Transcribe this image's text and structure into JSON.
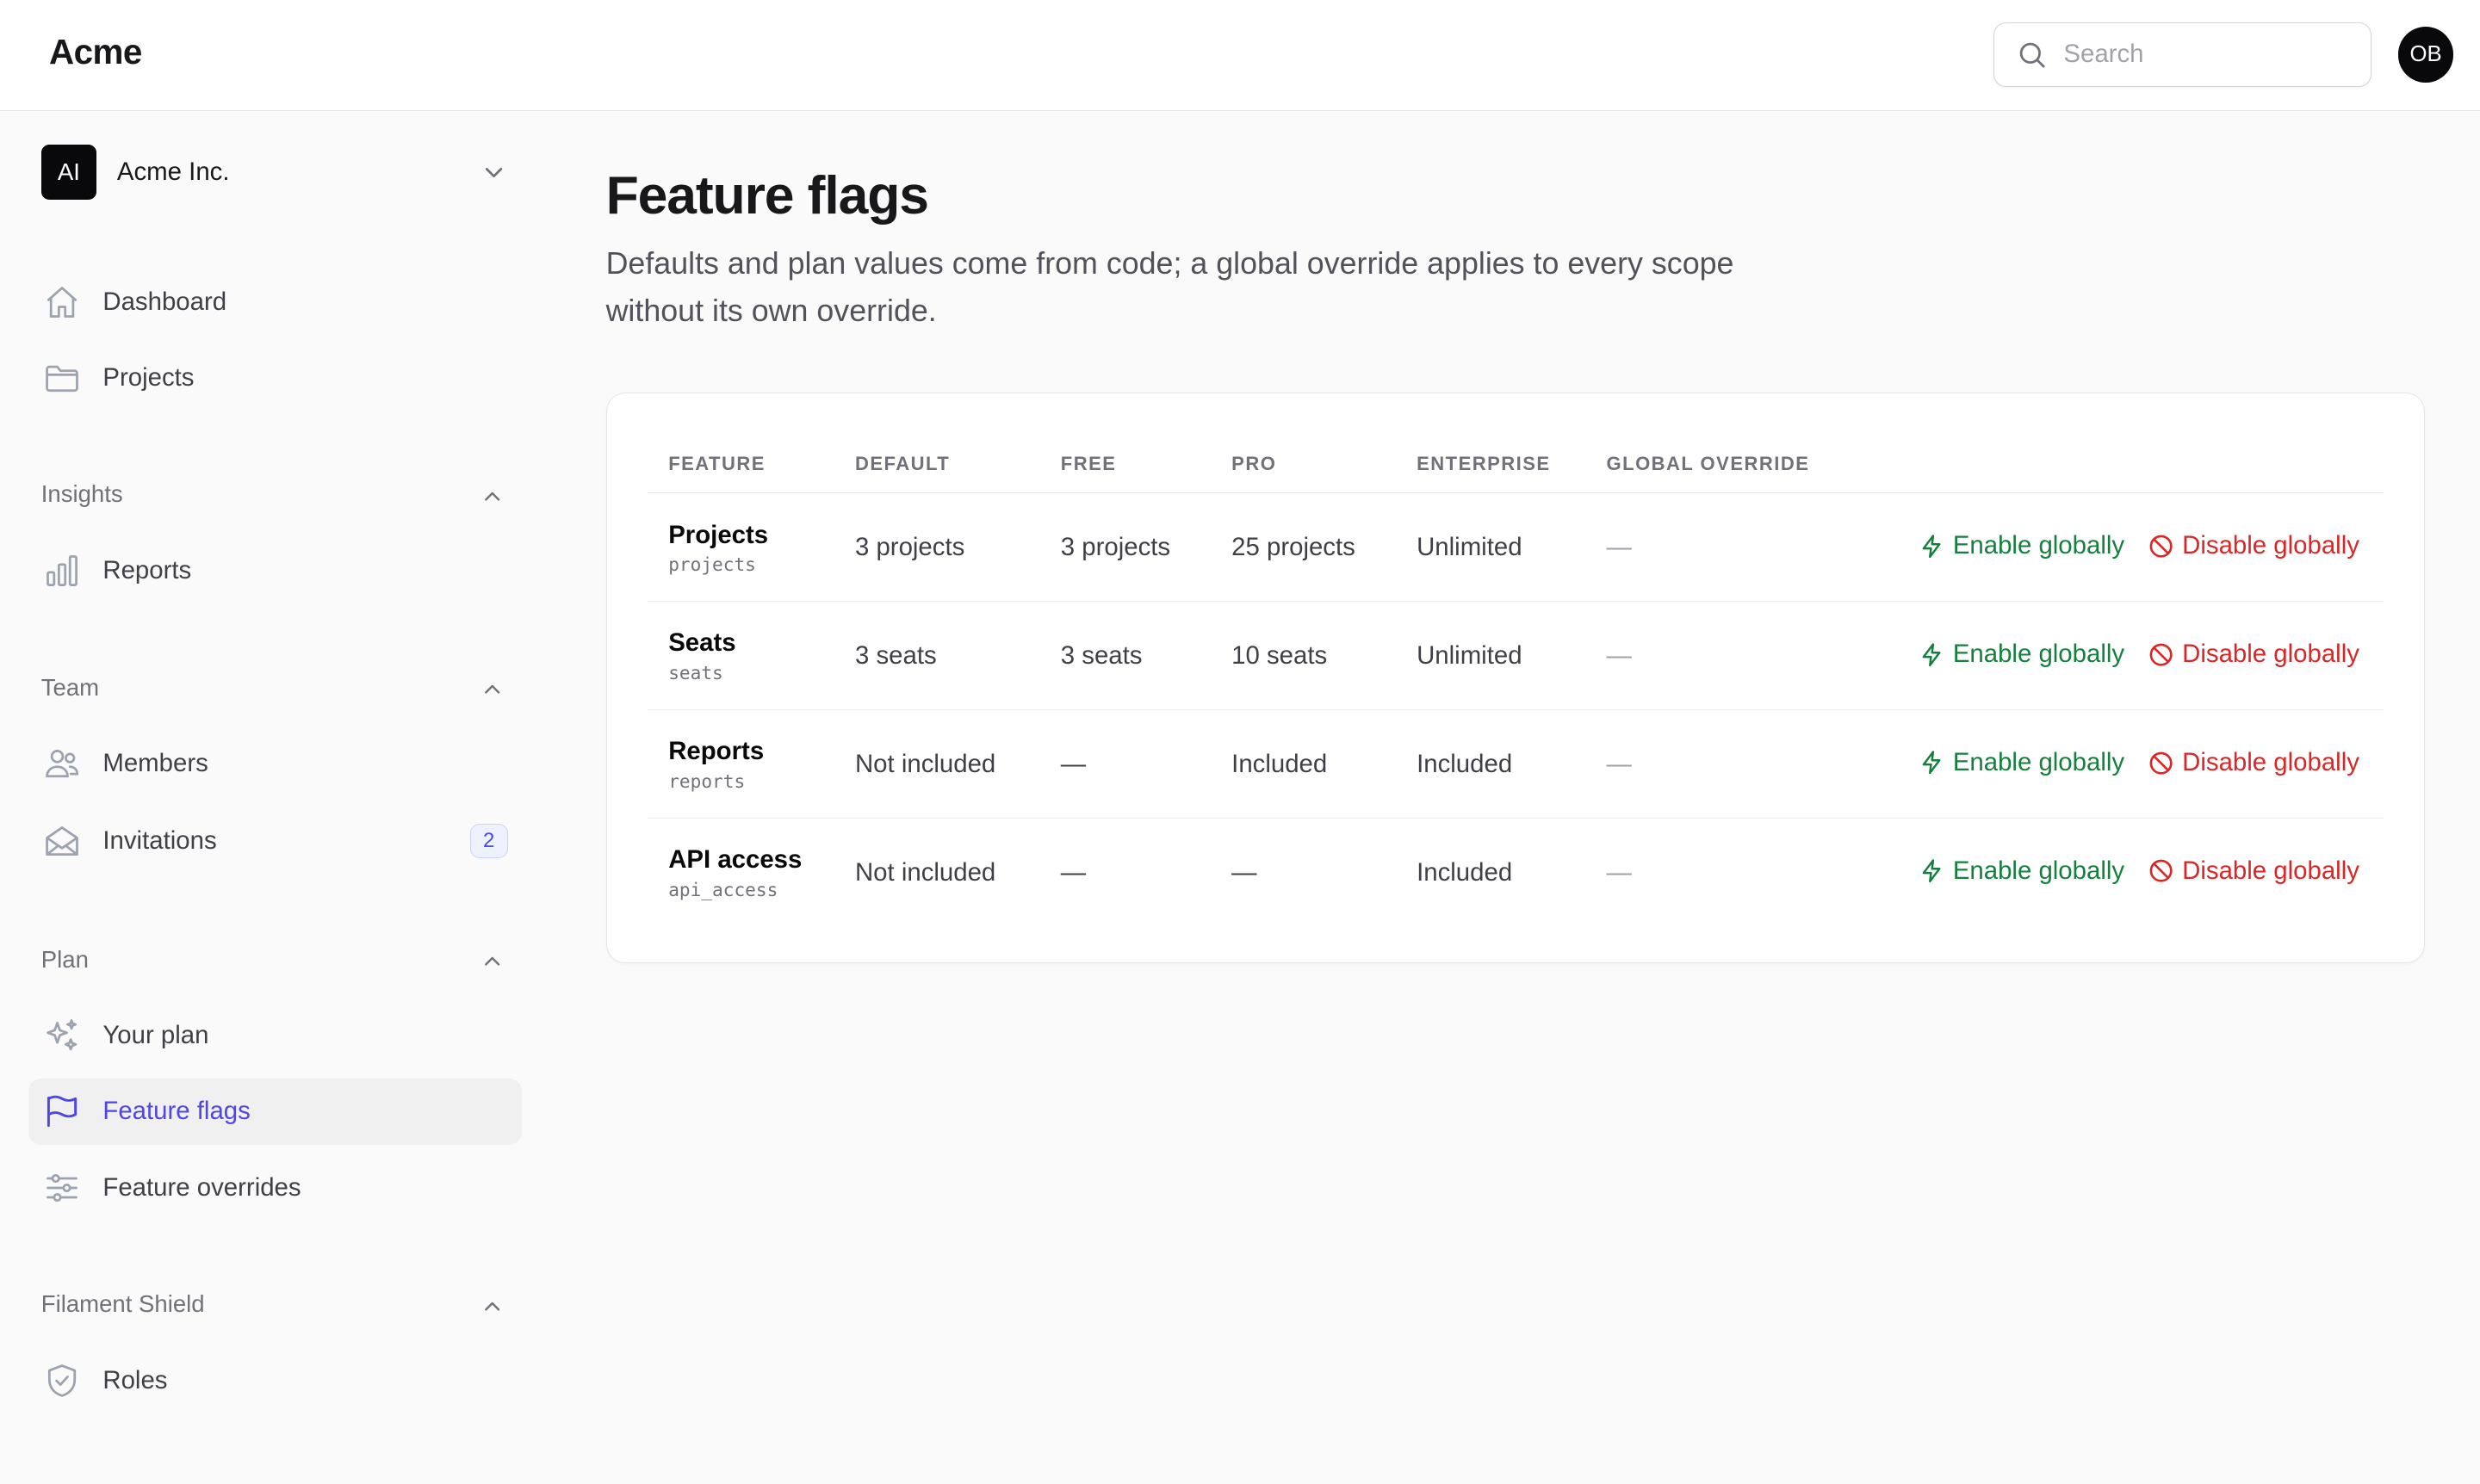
{
  "brand": "Acme",
  "search": {
    "placeholder": "Search"
  },
  "user": {
    "initials": "OB"
  },
  "tenant": {
    "initials": "AI",
    "name": "Acme Inc."
  },
  "nav": {
    "dashboard": "Dashboard",
    "projects": "Projects",
    "insights": {
      "label": "Insights",
      "reports": "Reports"
    },
    "team": {
      "label": "Team",
      "members": "Members",
      "invitations": "Invitations",
      "invitations_badge": "2"
    },
    "plan": {
      "label": "Plan",
      "your_plan": "Your plan",
      "feature_flags": "Feature flags",
      "feature_overrides": "Feature overrides"
    },
    "shield": {
      "label": "Filament Shield",
      "roles": "Roles"
    }
  },
  "page": {
    "title": "Feature flags",
    "description": "Defaults and plan values come from code; a global override applies to every scope without its own override."
  },
  "table": {
    "headers": [
      "FEATURE",
      "DEFAULT",
      "FREE",
      "PRO",
      "ENTERPRISE",
      "GLOBAL OVERRIDE"
    ],
    "rows": [
      {
        "name": "Projects",
        "key": "projects",
        "default": "3 projects",
        "free": "3 projects",
        "pro": "25 projects",
        "enterprise": "Unlimited",
        "global": "—"
      },
      {
        "name": "Seats",
        "key": "seats",
        "default": "3 seats",
        "free": "3 seats",
        "pro": "10 seats",
        "enterprise": "Unlimited",
        "global": "—"
      },
      {
        "name": "Reports",
        "key": "reports",
        "default": "Not included",
        "free": "—",
        "pro": "Included",
        "enterprise": "Included",
        "global": "—"
      },
      {
        "name": "API access",
        "key": "api_access",
        "default": "Not included",
        "free": "—",
        "pro": "—",
        "enterprise": "Included",
        "global": "—"
      }
    ],
    "actions": {
      "enable": "Enable globally",
      "disable": "Disable globally"
    }
  },
  "colors": {
    "accent": "#4f46e5",
    "enable": "#15803d",
    "disable": "#dc2626"
  }
}
